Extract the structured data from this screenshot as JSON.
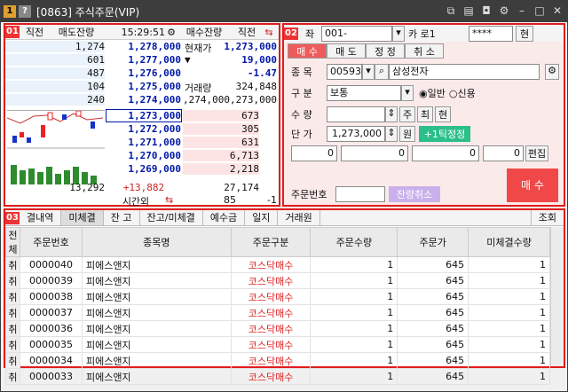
{
  "window": {
    "title": "[0863] 주식주문(VIP)",
    "btn1": "1",
    "btn2": "?"
  },
  "p1": {
    "num": "01",
    "hdr": [
      "직전",
      "매도잔량",
      "15:29:51",
      "매수잔량",
      "직전"
    ],
    "asks": [
      {
        "q": "1,274",
        "p": "1,278,000"
      },
      {
        "q": "601",
        "p": "1,277,000"
      },
      {
        "q": "487",
        "p": "1,276,000"
      },
      {
        "q": "104",
        "p": "1,275,000"
      },
      {
        "q": "240",
        "p": "1,274,000"
      }
    ],
    "info": [
      {
        "l": "현재가",
        "v": "1,273,000"
      },
      {
        "l": "▼",
        "v": "19,000"
      },
      {
        "l": "",
        "v": "-1.47"
      },
      {
        "l": "거래량",
        "v": "324,848"
      },
      {
        "l": "",
        "v": ",274,000,273,000"
      }
    ],
    "bids": [
      {
        "p": "1,273,000",
        "q": "673"
      },
      {
        "p": "1,272,000",
        "q": "305"
      },
      {
        "p": "1,271,000",
        "q": "631"
      },
      {
        "p": "1,270,000",
        "q": "6,713"
      },
      {
        "p": "1,269,000",
        "q": "2,218"
      }
    ],
    "total_ask": "13,292",
    "diff": "+13,882",
    "total_bid": "27,174",
    "after_label": "시간외",
    "after_q": "85",
    "after_v": "-1"
  },
  "p2": {
    "num": "02",
    "acct_label": "좌",
    "acct": "001-",
    "acct_type": "카 로1",
    "pw": "****",
    "btn_cur": "현",
    "tabs": [
      "매 수",
      "매 도",
      "정 정",
      "취 소"
    ],
    "code_label": "종 목",
    "code": "005930",
    "name": "삼성전자",
    "type_label": "구 분",
    "type": "보통",
    "r1": "일반",
    "r2": "신용",
    "qty_label": "수 량",
    "qbtns": [
      "주",
      "최",
      "현"
    ],
    "price_label": "단 가",
    "price": "1,273,000",
    "won": "원",
    "tick": "+1틱정정",
    "boxes": [
      "0",
      "0",
      "0",
      "0"
    ],
    "edit": "편집",
    "ordno_label": "주문번호",
    "cancel_rest": "잔량취소",
    "buy": "매 수"
  },
  "p3": {
    "num": "03",
    "tabs": [
      "결내역",
      "미체결",
      "잔 고",
      "잔고/미체결",
      "예수금",
      "일지",
      "거래원"
    ],
    "query": "조회",
    "cols": [
      "전체",
      "주문번호",
      "종목명",
      "주문구분",
      "주문수량",
      "주문가",
      "미체결수량"
    ],
    "rows": [
      {
        "c": "취",
        "no": "0000040",
        "nm": "피에스앤지",
        "t": "코스닥매수",
        "q": "1",
        "p": "645",
        "r": "1"
      },
      {
        "c": "취",
        "no": "0000039",
        "nm": "피에스앤지",
        "t": "코스닥매수",
        "q": "1",
        "p": "645",
        "r": "1"
      },
      {
        "c": "취",
        "no": "0000038",
        "nm": "피에스앤지",
        "t": "코스닥매수",
        "q": "1",
        "p": "645",
        "r": "1"
      },
      {
        "c": "취",
        "no": "0000037",
        "nm": "피에스앤지",
        "t": "코스닥매수",
        "q": "1",
        "p": "645",
        "r": "1"
      },
      {
        "c": "취",
        "no": "0000036",
        "nm": "피에스앤지",
        "t": "코스닥매수",
        "q": "1",
        "p": "645",
        "r": "1"
      },
      {
        "c": "취",
        "no": "0000035",
        "nm": "피에스앤지",
        "t": "코스닥매수",
        "q": "1",
        "p": "645",
        "r": "1"
      },
      {
        "c": "취",
        "no": "0000034",
        "nm": "피에스앤지",
        "t": "코스닥매수",
        "q": "1",
        "p": "645",
        "r": "1"
      },
      {
        "c": "취",
        "no": "0000033",
        "nm": "피에스앤지",
        "t": "코스닥매수",
        "q": "1",
        "p": "645",
        "r": "1"
      }
    ]
  },
  "colors": {
    "accent": "#e11c1c",
    "buy": "#f04848",
    "tick": "#2bbf8a",
    "blue": "#0018a8"
  }
}
